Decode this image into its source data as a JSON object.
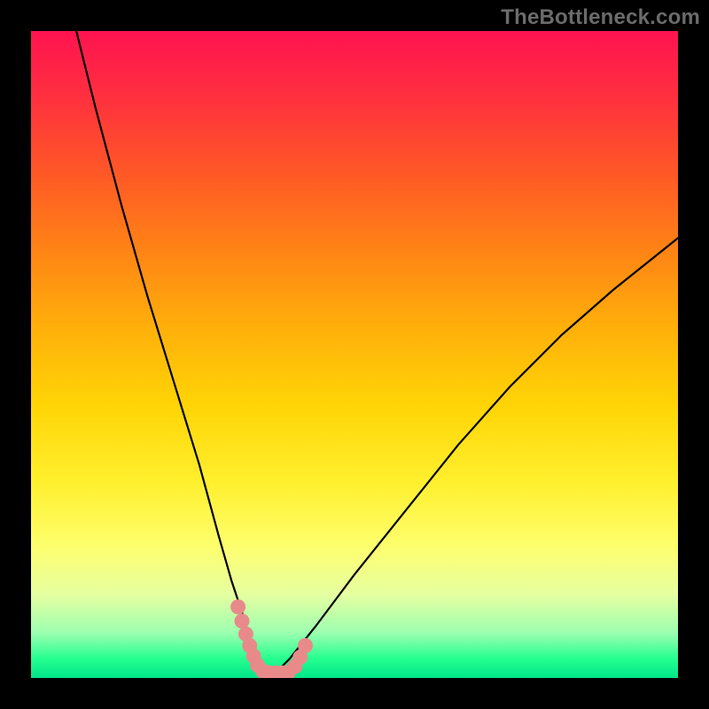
{
  "watermark": "TheBottleneck.com",
  "chart_data": {
    "type": "line",
    "title": "",
    "xlabel": "",
    "ylabel": "",
    "xlim": [
      0,
      100
    ],
    "ylim": [
      0,
      100
    ],
    "series": [
      {
        "name": "bottleneck-curve",
        "x": [
          7,
          10,
          14,
          18,
          22,
          26,
          29,
          31,
          33,
          34,
          35,
          36,
          37,
          38,
          40,
          44,
          50,
          58,
          66,
          74,
          82,
          90,
          100
        ],
        "y": [
          100,
          88,
          73,
          59,
          46,
          33,
          22,
          15,
          9,
          5,
          2,
          0.5,
          0.5,
          1,
          3,
          8,
          16,
          26,
          36,
          45,
          53,
          60,
          68
        ]
      }
    ],
    "flat_zone": {
      "x_start": 34.5,
      "x_end": 38.5,
      "y": 0.5
    },
    "markers": {
      "name": "pink-dots",
      "color": "#e98a8a",
      "points": [
        {
          "x": 32.0,
          "y": 11.0
        },
        {
          "x": 32.6,
          "y": 8.8
        },
        {
          "x": 33.2,
          "y": 6.8
        },
        {
          "x": 33.8,
          "y": 5.0
        },
        {
          "x": 34.4,
          "y": 3.4
        },
        {
          "x": 35.0,
          "y": 2.0
        },
        {
          "x": 35.8,
          "y": 1.1
        },
        {
          "x": 36.8,
          "y": 0.8
        },
        {
          "x": 37.8,
          "y": 0.8
        },
        {
          "x": 38.8,
          "y": 0.8
        },
        {
          "x": 39.8,
          "y": 0.9
        },
        {
          "x": 40.8,
          "y": 1.8
        },
        {
          "x": 41.6,
          "y": 3.2
        },
        {
          "x": 42.4,
          "y": 5.0
        }
      ]
    }
  }
}
